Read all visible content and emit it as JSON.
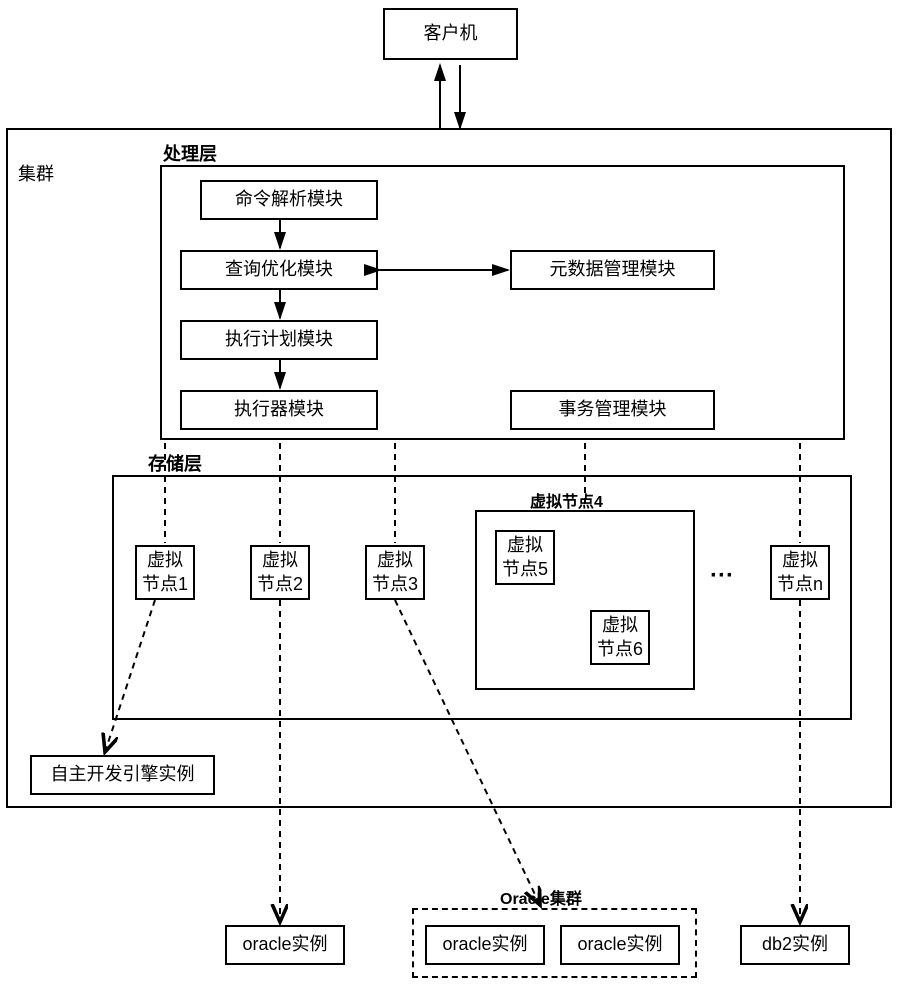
{
  "client": "客户机",
  "cluster_label": "集群",
  "processing_layer_label": "处理层",
  "storage_layer_label": "存储层",
  "modules": {
    "command_parse": "命令解析模块",
    "query_opt": "查询优化模块",
    "exec_plan": "执行计划模块",
    "executor": "执行器模块",
    "metadata": "元数据管理模块",
    "transaction": "事务管理模块"
  },
  "virtual_node_4_label": "虚拟节点4",
  "virtual_nodes": {
    "n1": "虚拟\n节点1",
    "n2": "虚拟\n节点2",
    "n3": "虚拟\n节点3",
    "n5": "虚拟\n节点5",
    "n6": "虚拟\n节点6",
    "nn": "虚拟\n节点n"
  },
  "ellipsis": "···",
  "self_engine": "自主开发引擎实例",
  "oracle_instance": "oracle实例",
  "oracle_cluster_label": "Oracle集群",
  "oracle_inst_a": "oracle实例",
  "oracle_inst_b": "oracle实例",
  "db2_instance": "db2实例"
}
